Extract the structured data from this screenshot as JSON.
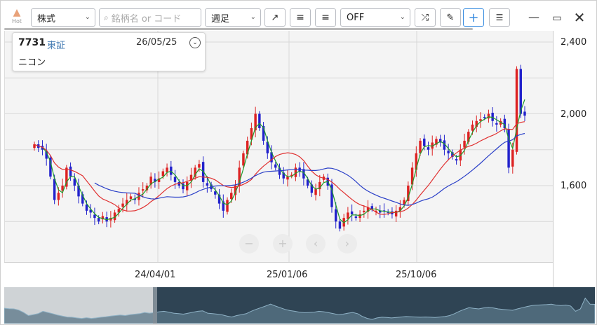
{
  "toolbar": {
    "hot_label": "Hot",
    "asset_type": "株式",
    "search_placeholder": "銘柄名 or コード",
    "period": "週足",
    "indicator": "OFF"
  },
  "info": {
    "code": "7731",
    "market": "東証",
    "date": "26/05/25",
    "name": "ニコン"
  },
  "y_axis": {
    "labels": [
      "2,400",
      "2,000",
      "1,600"
    ]
  },
  "x_axis": {
    "labels": [
      "24/04/01",
      "25/01/06",
      "25/10/06"
    ]
  },
  "nav": {
    "zoom_out": "−",
    "zoom_in": "+",
    "prev": "‹",
    "next": "›"
  },
  "colors": {
    "up": "#dd2222",
    "down": "#2222cc",
    "ma_short": "#1f9a2a",
    "ma_mid": "#e03030",
    "ma_long": "#2a3fc8"
  },
  "chart_data": {
    "type": "candlestick",
    "title": "",
    "ylim": [
      1200,
      2500
    ],
    "y_ticks": [
      1600,
      2000,
      2400
    ],
    "x_ticks": [
      "24/04/01",
      "25/01/06",
      "25/10/06"
    ],
    "indicators": [
      "moving average (short)",
      "moving average (mid)",
      "moving average (long)"
    ],
    "close": [
      1830,
      1810,
      1800,
      1750,
      1650,
      1520,
      1560,
      1600,
      1700,
      1650,
      1600,
      1540,
      1500,
      1460,
      1450,
      1420,
      1400,
      1430,
      1400,
      1420,
      1450,
      1470,
      1500,
      1520,
      1540,
      1520,
      1560,
      1580,
      1600,
      1650,
      1620,
      1640,
      1680,
      1700,
      1660,
      1620,
      1600,
      1580,
      1620,
      1660,
      1700,
      1720,
      1620,
      1600,
      1580,
      1550,
      1500,
      1460,
      1520,
      1560,
      1600,
      1700,
      1780,
      1850,
      1920,
      2000,
      1920,
      1850,
      1780,
      1730,
      1700,
      1660,
      1640,
      1650,
      1660,
      1700,
      1680,
      1640,
      1600,
      1560,
      1580,
      1620,
      1650,
      1600,
      1480,
      1400,
      1360,
      1420,
      1450,
      1440,
      1420,
      1440,
      1460,
      1480,
      1470,
      1460,
      1450,
      1460,
      1450,
      1440,
      1460,
      1480,
      1520,
      1600,
      1700,
      1780,
      1850,
      1820,
      1800,
      1840,
      1860,
      1840,
      1800,
      1780,
      1760,
      1740,
      1800,
      1850,
      1900,
      1940,
      1960,
      1970,
      1980,
      2000,
      1960,
      1940,
      1960,
      1920,
      1700,
      1800,
      2250,
      2000,
      1990
    ]
  }
}
